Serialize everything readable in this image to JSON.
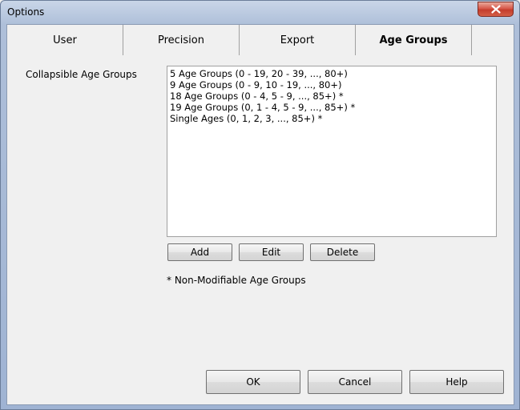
{
  "window": {
    "title": "Options"
  },
  "tabs": [
    {
      "label": "User",
      "active": false
    },
    {
      "label": "Precision",
      "active": false
    },
    {
      "label": "Export",
      "active": false
    },
    {
      "label": "Age Groups",
      "active": true
    }
  ],
  "age_groups": {
    "label": "Collapsible Age Groups",
    "items": [
      "5 Age Groups (0 - 19, 20 - 39, ..., 80+)",
      "9 Age Groups (0 - 9, 10 - 19, ..., 80+)",
      "18 Age Groups (0 - 4, 5 - 9, ..., 85+) *",
      "19 Age Groups (0, 1 - 4, 5 - 9, ..., 85+) *",
      "Single Ages (0, 1, 2, 3, ..., 85+) *"
    ],
    "add_label": "Add",
    "edit_label": "Edit",
    "delete_label": "Delete",
    "note": "* Non-Modifiable Age Groups"
  },
  "footer": {
    "ok_label": "OK",
    "cancel_label": "Cancel",
    "help_label": "Help"
  },
  "icons": {
    "close": "close-icon"
  }
}
